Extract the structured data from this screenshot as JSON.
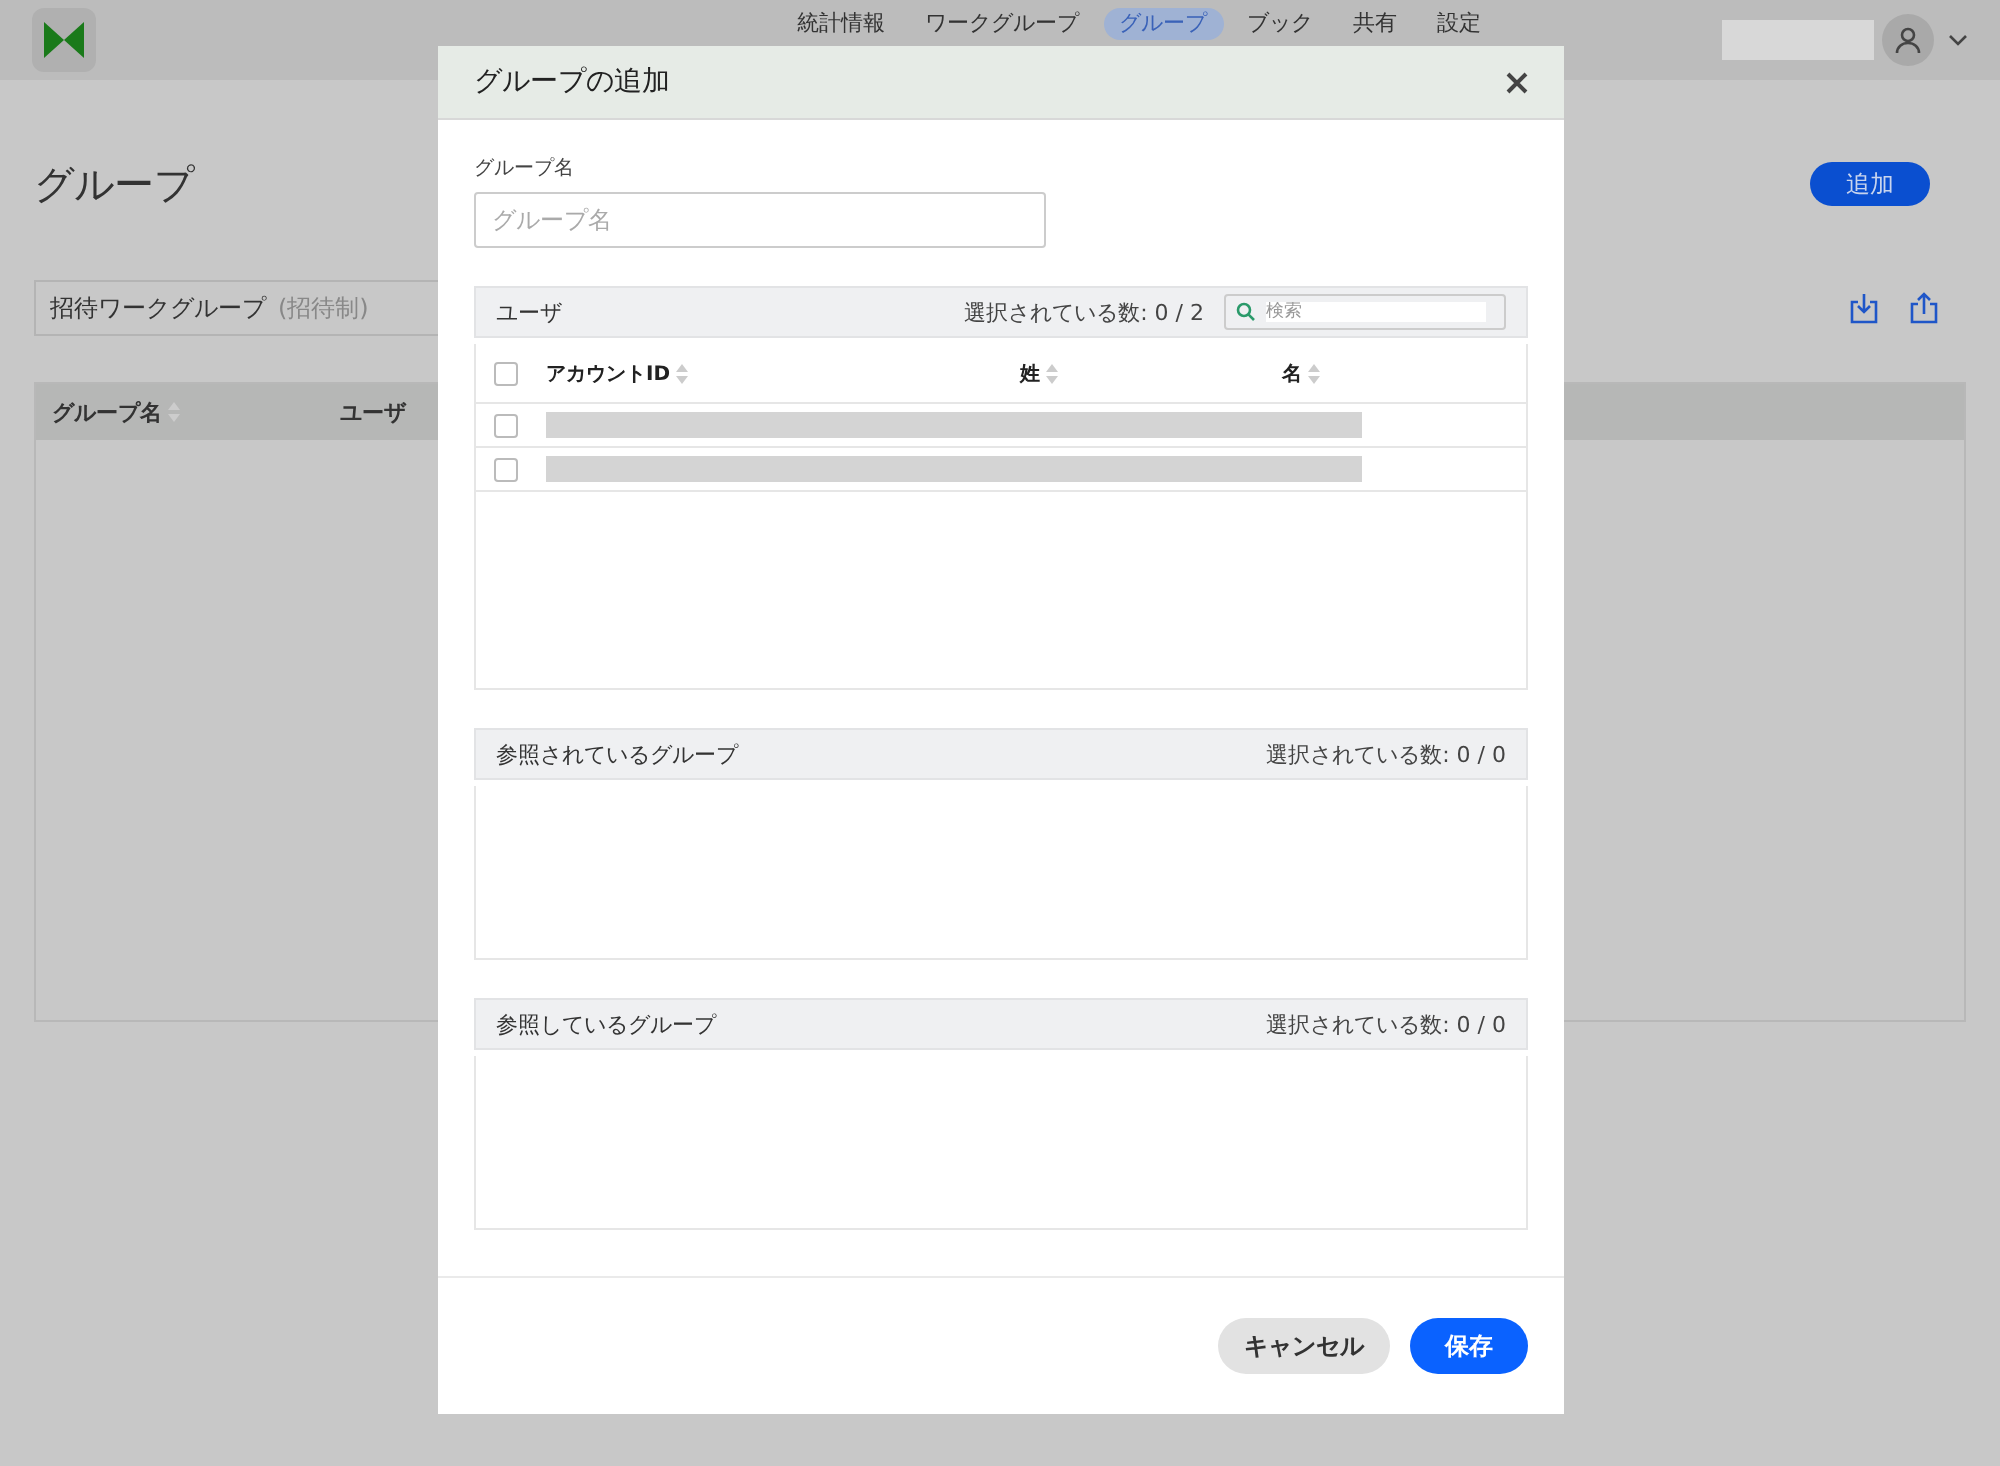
{
  "header": {
    "nav": [
      {
        "label": "統計情報",
        "selected": false
      },
      {
        "label": "ワークグループ",
        "selected": false
      },
      {
        "label": "グループ",
        "selected": true
      },
      {
        "label": "ブック",
        "selected": false
      },
      {
        "label": "共有",
        "selected": false
      },
      {
        "label": "設定",
        "selected": false
      }
    ]
  },
  "page": {
    "title": "グループ",
    "add_button": "追加",
    "filter": {
      "value": "招待ワークグループ",
      "note": "(招待制)"
    },
    "table": {
      "columns": [
        {
          "label": "グループ名",
          "kind": "sortable"
        },
        {
          "label": "ユーザ",
          "kind": "plain"
        }
      ]
    }
  },
  "dialog": {
    "title": "グループの追加",
    "name_label": "グループ名",
    "name_placeholder": "グループ名",
    "users": {
      "title": "ユーザ",
      "count": "選択されている数: 0 / 2",
      "search_placeholder": "検索",
      "all_checked": false,
      "columns": [
        "アカウントID",
        "姓",
        "名"
      ],
      "rows": [
        {
          "checked": false
        },
        {
          "checked": false
        }
      ]
    },
    "sections": [
      {
        "title": "参照されているグループ",
        "count": "選択されている数: 0 / 0"
      },
      {
        "title": "参照しているグループ",
        "count": "選択されている数: 0 / 0"
      }
    ],
    "buttons": [
      {
        "label": "キャンセル",
        "kind": "secondary"
      },
      {
        "label": "保存",
        "kind": "primary"
      }
    ]
  }
}
